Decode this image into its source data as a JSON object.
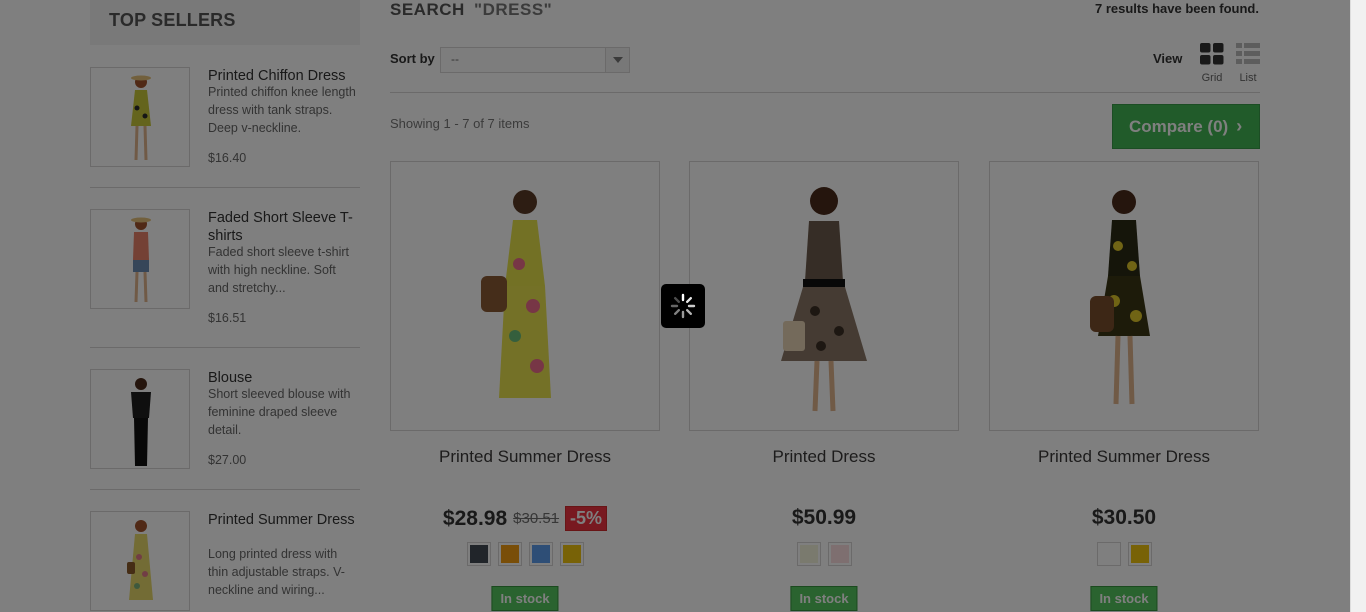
{
  "sidebar": {
    "title": "TOP SELLERS",
    "items": [
      {
        "name": "Printed Chiffon Dress",
        "desc": "Printed chiffon knee length dress with tank straps. Deep v-neckline.",
        "price": "$16.40"
      },
      {
        "name": "Faded Short Sleeve T-shirts",
        "desc": "Faded short sleeve t-shirt with high neckline. Soft and stretchy...",
        "price": "$16.51"
      },
      {
        "name": "Blouse",
        "desc": "Short sleeved blouse with feminine draped sleeve detail.",
        "price": "$27.00"
      },
      {
        "name": "Printed Summer Dress",
        "desc": "Long printed dress with thin adjustable straps. V-neckline and wiring...",
        "price": ""
      }
    ]
  },
  "header": {
    "title": "SEARCH",
    "query": "\"DRESS\"",
    "results": "7 results have been found."
  },
  "toolbar": {
    "sort_label": "Sort by",
    "sort_value": "--",
    "view_label": "View",
    "grid_label": "Grid",
    "list_label": "List",
    "showing": "Showing 1 - 7 of 7 items",
    "compare_label": "Compare (0)"
  },
  "products": [
    {
      "name": "Printed Summer Dress",
      "price": "$28.98",
      "old_price": "$30.51",
      "discount": "-5%",
      "stock": "In stock",
      "swatches": [
        "#434a54",
        "#f39c11",
        "#5d9cec",
        "#f1c40f"
      ]
    },
    {
      "name": "Printed Dress",
      "price": "$50.99",
      "stock": "In stock",
      "swatches": [
        "#f5f5dc",
        "#fcdfe1"
      ]
    },
    {
      "name": "Printed Summer Dress",
      "price": "$30.50",
      "stock": "In stock",
      "swatches": [
        "#ffffff",
        "#f1c40f"
      ]
    }
  ],
  "colors": {
    "accent_green": "#43b754",
    "stock_green": "#55c65e",
    "discount_red": "#f13340",
    "overlay": "rgba(0,0,0,0.5)"
  }
}
